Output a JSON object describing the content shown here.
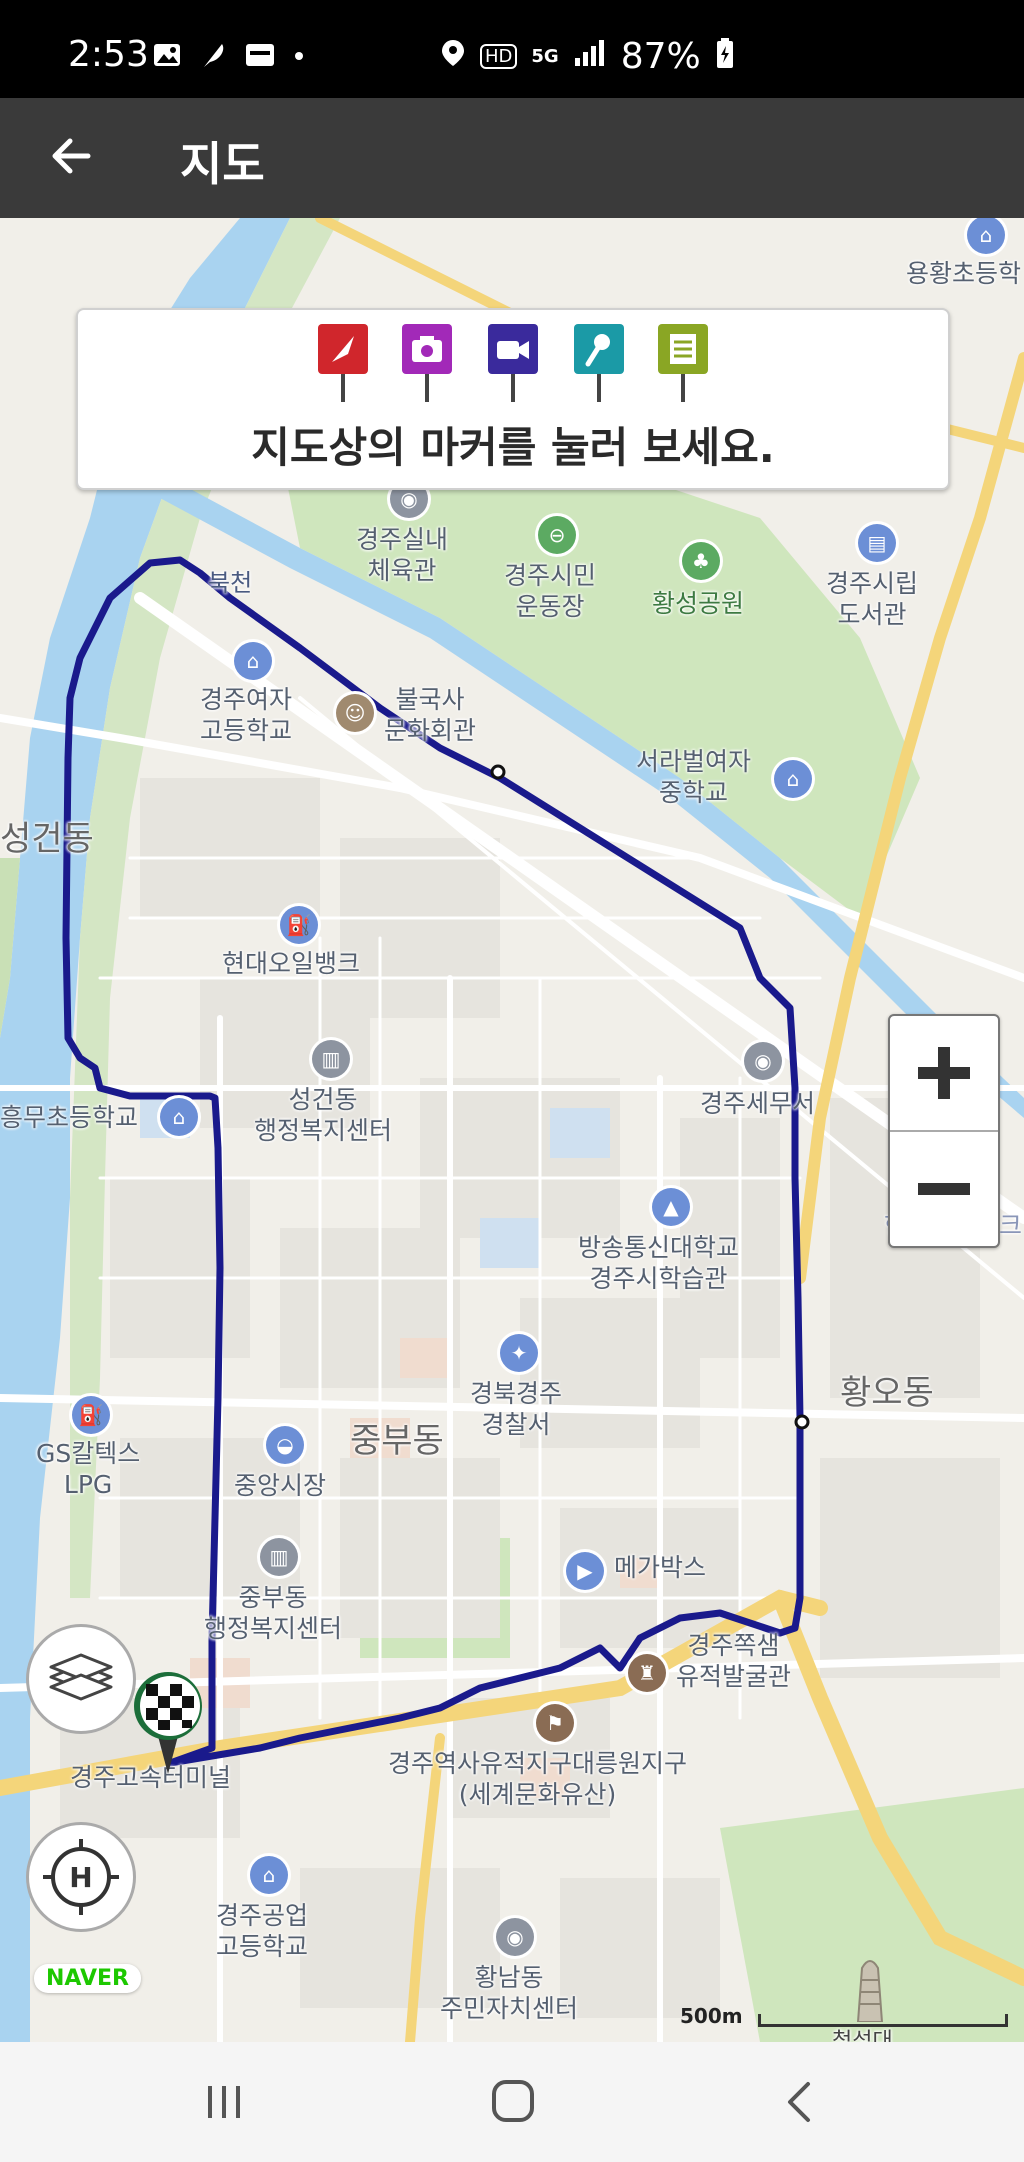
{
  "status_bar": {
    "time": "2:53",
    "battery": "87%",
    "icons": [
      "gallery-icon",
      "feather-icon",
      "pay-icon",
      "dot-icon",
      "location-icon",
      "hd-icon",
      "5g-icon",
      "signal-icon",
      "battery-icon"
    ],
    "hd": "HD",
    "net": "5G"
  },
  "app_bar": {
    "title": "지도",
    "back_icon": "arrow-left-icon"
  },
  "info_card": {
    "hint": "지도상의 마커를 눌러 보세요.",
    "markers": [
      {
        "icon": "flag-marker-icon",
        "color": "#d0262c"
      },
      {
        "icon": "camera-marker-icon",
        "color": "#a229b8"
      },
      {
        "icon": "video-marker-icon",
        "color": "#3a2a9c"
      },
      {
        "icon": "microphone-marker-icon",
        "color": "#1b9aa6"
      },
      {
        "icon": "note-marker-icon",
        "color": "#8aa624"
      }
    ]
  },
  "map": {
    "route_color": "#1a1a8c",
    "areas": {
      "seonggeon": "성건동",
      "jungbu": "중부동",
      "hwango": "황오동"
    },
    "labels": {
      "bukcheon": "북천",
      "yonghwang": "용황초등학",
      "gymnasium": "경주실내\n체육관",
      "stadium": "경주시민\n운동장",
      "hwangseong_park": "황성공원",
      "library": "경주시립\n도서관",
      "girls_high": "경주여자\n고등학교",
      "bulguksa_hall": "불국사\n문화회관",
      "seorabeol_middle": "서라벌여자\n중학교",
      "hyundai_oil": "현대오일뱅크",
      "tax_office": "경주세무서",
      "seonggeon_center": "성건동\n행정복지센터",
      "heungmu_elem": "흥무초등학교",
      "hyundai_oil_right": "현대오일뱅크",
      "open_univ": "방송통신대학교\n경주시학습관",
      "police": "경북경주\n경찰서",
      "gs_lpg": "GS칼텍스\nLPG",
      "central_market": "중앙시장",
      "megabox": "메가박스",
      "jungbu_center": "중부동\n행정복지센터",
      "jjoksaem": "경주쪽샘\n유적발굴관",
      "express_terminal": "경주고속터미널",
      "heritage": "경주역사유적지구대릉원지구\n(세계문화유산)",
      "tech_high": "경주공업\n고등학교",
      "hwangnam_center": "황남동\n주민자치센터",
      "cheomseongdae": "첨성대"
    },
    "brand": "NAVER",
    "scale": "500m"
  },
  "controls": {
    "zoom_in": "plus-icon",
    "zoom_out": "minus-icon",
    "layers": "layers-icon",
    "helipad": "helipad-icon",
    "finish": "checkered-flag-icon"
  },
  "nav_bar": {
    "recents": "recents-icon",
    "home": "home-icon",
    "back": "back-icon"
  }
}
